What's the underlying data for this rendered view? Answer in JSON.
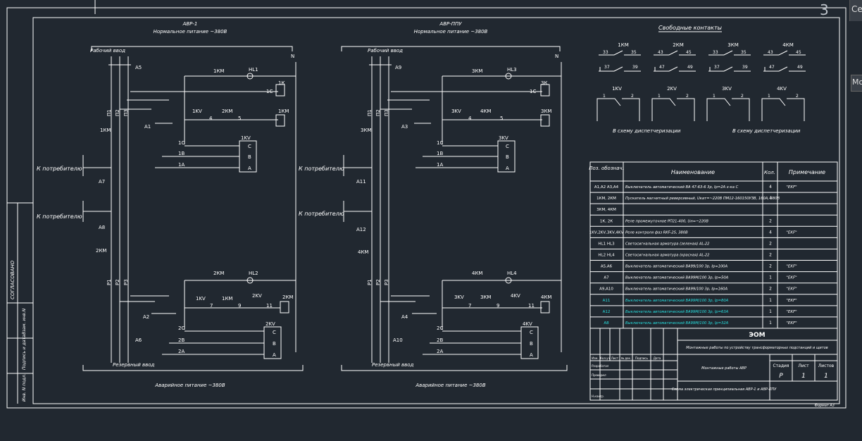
{
  "ui": {
    "viewcube_number": "3",
    "corner_button_1": "Се",
    "corner_button_2": "Mo"
  },
  "avr1": {
    "title": "АВР-1",
    "normal_supply": "Нормальное питание ~380В",
    "emergency_supply": "Аварийное питание ~380В",
    "work_input": "Рабочий ввод",
    "reserve_input": "Резервный ввод",
    "consumer1": "К потребителю",
    "consumer2": "К потребителю",
    "n_label": "N",
    "breaker_top": "A5",
    "breaker_bottom": "A6",
    "breaker_c1": "A7",
    "breaker_c2": "A8",
    "km_top": "1КМ",
    "km_bottom": "2КМ",
    "sw_top": "A1",
    "sw_bottom": "A2",
    "phases_top": [
      "П1",
      "П2",
      "П3"
    ],
    "phases_bottom": [
      "Р1",
      "Р2",
      "Р3"
    ],
    "relay_k_top": "1К",
    "hl_top": "HL1",
    "relay_kv_top": "1KV",
    "relay_k_label_top": "1С",
    "circuit1": {
      "a": "1KV",
      "b": "2КМ",
      "n4": "4",
      "n5": "5",
      "coil": "1КМ",
      "km": "1КМ"
    },
    "relay_kv_box_top": "1KV",
    "lines_top": [
      "1С",
      "1В",
      "1А"
    ],
    "box_labels": [
      "C",
      "B",
      "A"
    ],
    "hl_bottom": "HL2",
    "km2_bottom": "2КМ",
    "circuit2": {
      "a": "1KV",
      "b": "1КМ",
      "c": "2KV",
      "n7": "7",
      "n9": "9",
      "n11": "11",
      "coil": "2КМ"
    },
    "relay_kv_box_bottom": "2KV",
    "lines_bottom": [
      "2С",
      "2В",
      "2А"
    ]
  },
  "avr2": {
    "title": "АВР-ППУ",
    "normal_supply": "Нормальное питание ~380В",
    "emergency_supply": "Аварийное питание ~380В",
    "work_input": "Рабочий ввод",
    "reserve_input": "Резервный ввод",
    "consumer1": "К потребителю",
    "consumer2": "К потребителю",
    "n_label": "N",
    "breaker_top": "A9",
    "breaker_bottom": "A10",
    "breaker_c1": "A11",
    "breaker_c2": "A12",
    "km_top": "3КМ",
    "km_bottom": "4КМ",
    "sw_top": "A3",
    "sw_bottom": "A4",
    "phases_top": [
      "П1",
      "П2",
      "П3"
    ],
    "phases_bottom": [
      "Р1",
      "Р2",
      "Р3"
    ],
    "relay_k_top": "3К",
    "hl_top": "HL3",
    "relay_k_label_top": "1С",
    "circuit1": {
      "a": "3KV",
      "b": "4КМ",
      "n4": "4",
      "n5": "5",
      "coil": "3КМ",
      "km": "3КМ"
    },
    "relay_kv_box_top": "3KV",
    "lines_top": [
      "1С",
      "1В",
      "1А"
    ],
    "box_labels": [
      "C",
      "B",
      "A"
    ],
    "hl_bottom": "HL4",
    "km2_bottom": "4КМ",
    "circuit2": {
      "a": "3KV",
      "b": "3КМ",
      "c": "4KV",
      "n7": "7",
      "n9": "9",
      "n11": "11",
      "coil": "4КМ"
    },
    "relay_kv_box_bottom": "4KV",
    "lines_bottom": [
      "2С",
      "2В",
      "2А"
    ]
  },
  "free_contacts": {
    "title": "Свободные контакты",
    "km": [
      {
        "name": "1КМ",
        "top": [
          "33",
          "35"
        ],
        "bot": [
          "37",
          "39"
        ]
      },
      {
        "name": "2КМ",
        "top": [
          "43",
          "45"
        ],
        "bot": [
          "47",
          "49"
        ]
      },
      {
        "name": "3КМ",
        "top": [
          "33",
          "35"
        ],
        "bot": [
          "37",
          "39"
        ]
      },
      {
        "name": "4КМ",
        "top": [
          "43",
          "45"
        ],
        "bot": [
          "47",
          "49"
        ]
      }
    ],
    "kv": [
      {
        "name": "1KV",
        "n1": "1",
        "n2": "2"
      },
      {
        "name": "2KV",
        "n1": "1",
        "n2": "2"
      },
      {
        "name": "3KV",
        "n1": "1",
        "n2": "2"
      },
      {
        "name": "4KV",
        "n1": "1",
        "n2": "2"
      }
    ],
    "dispatch1": "В схему диспетчеризации",
    "dispatch2": "В схему диспетчеризации"
  },
  "spec": {
    "headers": [
      "Поз. обознач.",
      "Наименование",
      "Кол.",
      "Примечание"
    ],
    "rows": [
      {
        "pos": "A1,A2  A3,A4",
        "name": "Выключатель автоматический ВА 47-63-6 3р, Iр=2А х-ка С",
        "qty": "4",
        "note": "\"EKF\"",
        "cyan": false
      },
      {
        "pos": "1КМ, 2КМ",
        "name": "Пускатель магнитный реверсивный, Uкат=~220В ПМ12-160150УЗВ, 160А, 380В",
        "qty": "4",
        "note": "",
        "cyan": false
      },
      {
        "pos": "3КМ, 4КМ",
        "name": "",
        "qty": "",
        "note": "",
        "cyan": false
      },
      {
        "pos": "1К,    2К",
        "name": "Реле промежуточное РП21-400, Uн=~220В",
        "qty": "2",
        "note": "",
        "cyan": false
      },
      {
        "pos": "1KV,2KV,3KV,4KV",
        "name": "Реле контроля фаз RKF-2S, 380В",
        "qty": "4",
        "note": "\"EKF\"",
        "cyan": false
      },
      {
        "pos": "HL1  HL3",
        "name": "Светосигнальная арматура (зеленая) AL-22",
        "qty": "2",
        "note": "",
        "cyan": false
      },
      {
        "pos": "HL2  HL4",
        "name": "Светосигнальная арматура (красная) AL-22",
        "qty": "2",
        "note": "",
        "cyan": false
      },
      {
        "pos": "A5,A6",
        "name": "Выключатель автоматический ВА99/100 3р, Iр=100А",
        "qty": "2",
        "note": "\"EKF\"",
        "cyan": false
      },
      {
        "pos": "A7",
        "name": "Выключатель автоматический ВА99М/100 3р, Iр=50А",
        "qty": "1",
        "note": "\"EKF\"",
        "cyan": false
      },
      {
        "pos": "A9,A10",
        "name": "Выключатель автоматический ВА99/100 3р, Iр=160А",
        "qty": "2",
        "note": "\"EKF\"",
        "cyan": false
      },
      {
        "pos": "A11",
        "name": "Выключатель автоматический ВА99М/100 3р, Iр=80А",
        "qty": "1",
        "note": "\"EKF\"",
        "cyan": true
      },
      {
        "pos": "A12",
        "name": "Выключатель автоматический ВА99М/100 3р, Iр=63А",
        "qty": "1",
        "note": "\"EKF\"",
        "cyan": true
      },
      {
        "pos": "A8",
        "name": "Выключатель автоматический ВА99М/100 3р, Iр=32А",
        "qty": "1",
        "note": "\"EKF\"",
        "cyan": true
      }
    ]
  },
  "stamp": {
    "code": "ЭОМ",
    "project": "Монтажные работы по устройству трансформаторных подстанций и щитов",
    "object": "Монтажные работы АВР",
    "sheet_title": "Схема электрическая принципиальная АВР-1 и АВР-ППУ",
    "col_headers": [
      "Изм.",
      "Кол.уч",
      "Лист",
      "№ док.",
      "Подпись",
      "Дата"
    ],
    "roles": [
      "Разработал",
      "Проверил",
      "",
      "Н.контр."
    ],
    "stage_h": "Стадия",
    "sheet_h": "Лист",
    "sheets_h": "Листов",
    "stage": "Р",
    "sheet": "1",
    "sheets": "1",
    "format": "Формат А3"
  },
  "left_strip": {
    "agreed": "СОГЛАСОВАНО",
    "cells": [
      "Взам. инв.N",
      "Подпись и дата",
      "Инв. N подл."
    ]
  }
}
